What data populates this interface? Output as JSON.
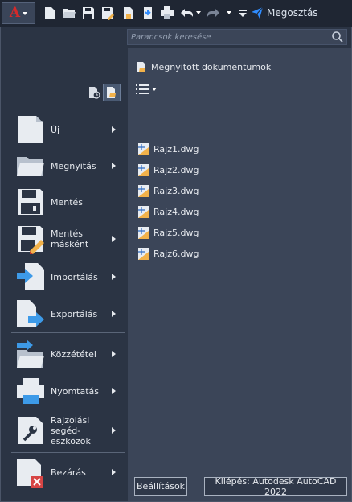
{
  "toolbar": {
    "app_logo": "A",
    "share_label": "Megosztás",
    "accent": "#d42a2a",
    "share_color": "#2f8cff"
  },
  "search": {
    "placeholder": "Parancsok keresése"
  },
  "menu": {
    "items": [
      {
        "label": "Új",
        "icon": "new-file-icon",
        "has_submenu": true
      },
      {
        "label": "Megnyitás",
        "icon": "open-folder-icon",
        "has_submenu": true
      },
      {
        "label": "Mentés",
        "icon": "save-icon",
        "has_submenu": false
      },
      {
        "label": "Mentés\nmásként",
        "icon": "save-as-icon",
        "has_submenu": true
      },
      {
        "label": "Importálás",
        "icon": "import-icon",
        "has_submenu": true
      },
      {
        "label": "Exportálás",
        "icon": "export-icon",
        "has_submenu": true
      },
      {
        "label": "Közzététel",
        "icon": "publish-icon",
        "has_submenu": true
      },
      {
        "label": "Nyomtatás",
        "icon": "print-icon",
        "has_submenu": true
      },
      {
        "label": "Rajzolási\nsegéd-\neszközök",
        "icon": "drawing-utilities-icon",
        "has_submenu": true
      },
      {
        "label": "Bezárás",
        "icon": "close-file-icon",
        "has_submenu": true
      }
    ]
  },
  "documents": {
    "header": "Megnyitott dokumentumok",
    "files": [
      "Rajz1.dwg",
      "Rajz2.dwg",
      "Rajz3.dwg",
      "Rajz4.dwg",
      "Rajz5.dwg",
      "Rajz6.dwg"
    ]
  },
  "footer": {
    "options_label": "Beállítások",
    "exit_label": "Kilépés: Autodesk AutoCAD 2022"
  }
}
